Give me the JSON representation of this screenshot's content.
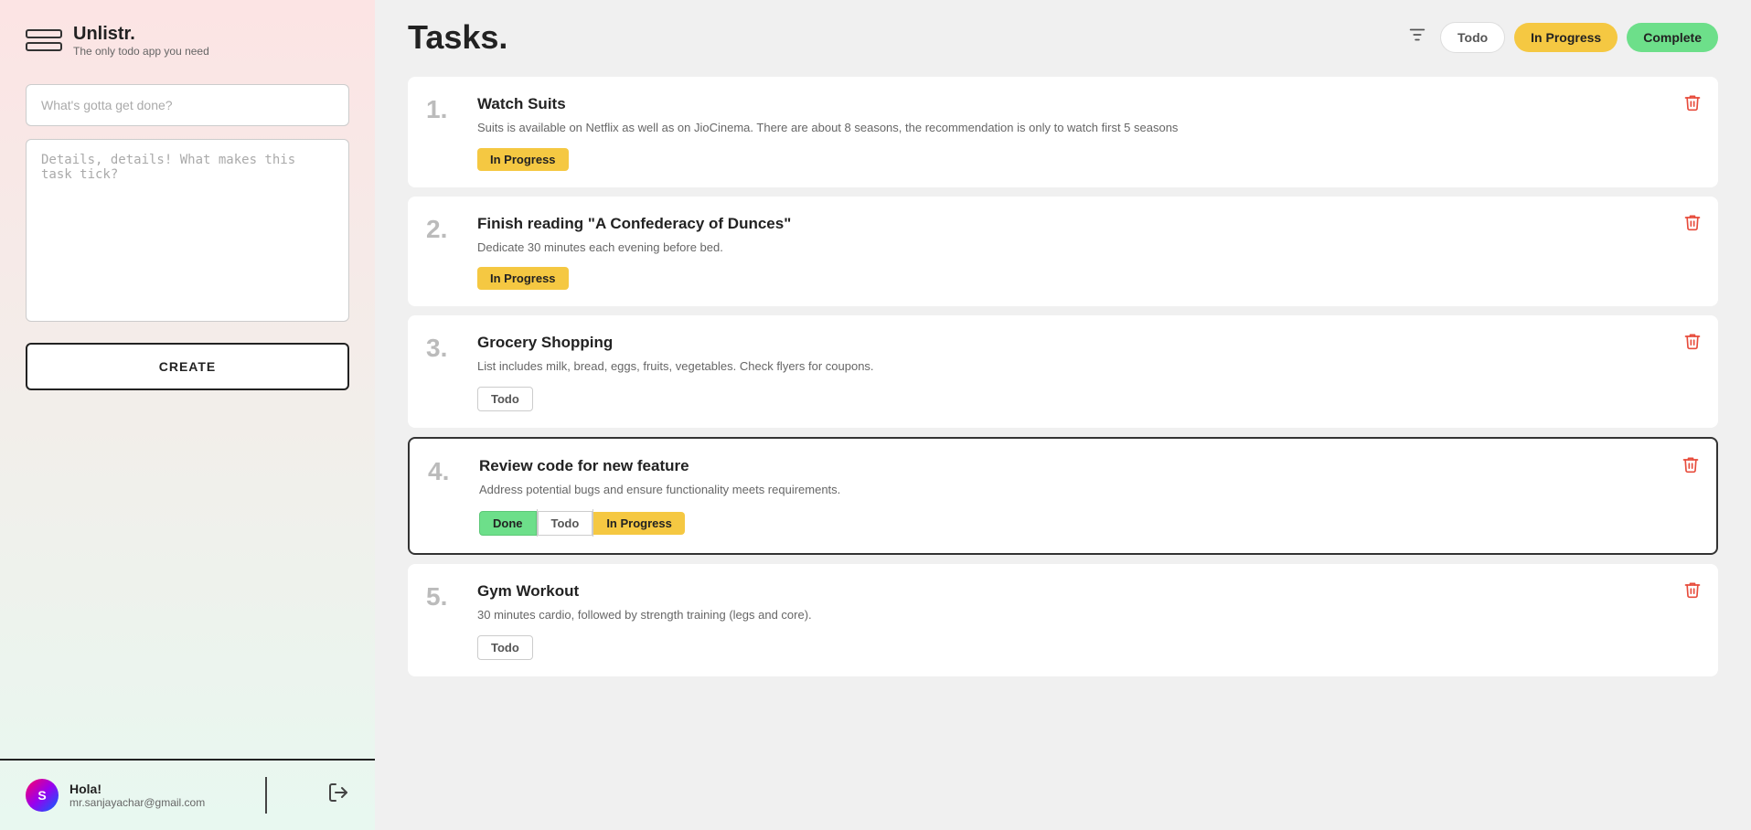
{
  "app": {
    "name": "Unlistr.",
    "tagline": "The only todo app you need"
  },
  "sidebar": {
    "title_placeholder": "What's gotta get done?",
    "detail_placeholder": "Details, details! What makes this task tick?",
    "create_label": "CREATE"
  },
  "user": {
    "greeting": "Hola!",
    "email": "mr.sanjayachar@gmail.com",
    "initials": "S"
  },
  "main": {
    "page_title": "Tasks.",
    "filter_icon_label": "filter-icon"
  },
  "filters": {
    "todo": "Todo",
    "in_progress": "In Progress",
    "complete": "Complete"
  },
  "tasks": [
    {
      "number": "1.",
      "name": "Watch Suits",
      "desc": "Suits is available on Netflix as well as on JioCinema. There are about 8 seasons, the recommendation is only to watch first 5 seasons",
      "status": "in-progress",
      "status_label": "In Progress",
      "selected": false
    },
    {
      "number": "2.",
      "name": "Finish reading \"A Confederacy of Dunces\"",
      "desc": "Dedicate 30 minutes each evening before bed.",
      "status": "in-progress",
      "status_label": "In Progress",
      "selected": false
    },
    {
      "number": "3.",
      "name": "Grocery Shopping",
      "desc": "List includes milk, bread, eggs, fruits, vegetables. Check flyers for coupons.",
      "status": "todo",
      "status_label": "Todo",
      "selected": false
    },
    {
      "number": "4.",
      "name": "Review code for new feature",
      "desc": "Address potential bugs and ensure functionality meets requirements.",
      "status": "multi",
      "status_buttons": [
        "Done",
        "Todo",
        "In Progress"
      ],
      "selected": true
    },
    {
      "number": "5.",
      "name": "Gym Workout",
      "desc": "30 minutes cardio, followed by strength training (legs and core).",
      "status": "todo",
      "status_label": "Todo",
      "selected": false
    }
  ]
}
